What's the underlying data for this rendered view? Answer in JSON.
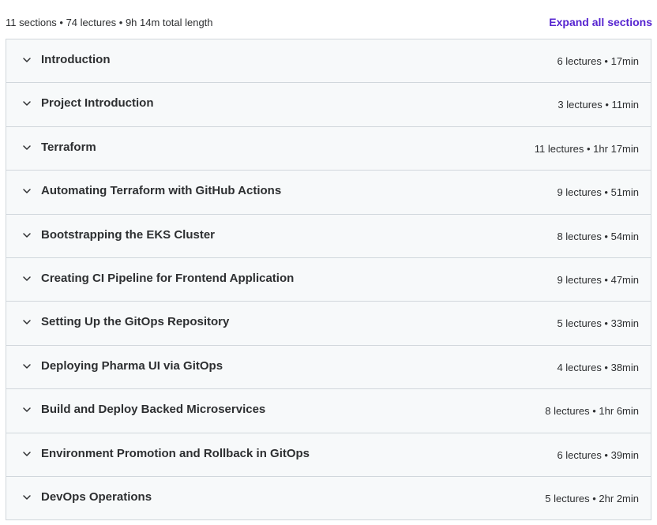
{
  "header": {
    "summary": "11 sections • 74 lectures • 9h 14m total length",
    "expand_all_label": "Expand all sections"
  },
  "sections": [
    {
      "title": "Introduction",
      "meta": "6 lectures • 17min",
      "icon": "chevron-down-icon"
    },
    {
      "title": "Project Introduction",
      "meta": "3 lectures • 11min",
      "icon": "chevron-down-icon"
    },
    {
      "title": "Terraform",
      "meta": "11 lectures • 1hr 17min",
      "icon": "chevron-down-icon"
    },
    {
      "title": "Automating Terraform with GitHub Actions",
      "meta": "9 lectures • 51min",
      "icon": "chevron-down-icon"
    },
    {
      "title": "Bootstrapping the EKS Cluster",
      "meta": "8 lectures • 54min",
      "icon": "chevron-down-icon"
    },
    {
      "title": "Creating CI Pipeline for Frontend Application",
      "meta": "9 lectures • 47min",
      "icon": "chevron-down-icon"
    },
    {
      "title": "Setting Up the GitOps Repository",
      "meta": "5 lectures • 33min",
      "icon": "chevron-down-icon"
    },
    {
      "title": "Deploying Pharma UI via GitOps",
      "meta": "4 lectures • 38min",
      "icon": "chevron-down-icon"
    },
    {
      "title": "Build and Deploy Backed Microservices",
      "meta": "8 lectures • 1hr 6min",
      "icon": "chevron-down-icon"
    },
    {
      "title": "Environment Promotion and Rollback in GitOps",
      "meta": "6 lectures • 39min",
      "icon": "chevron-down-icon"
    },
    {
      "title": "DevOps Operations",
      "meta": "5 lectures • 2hr 2min",
      "icon": "chevron-down-icon"
    }
  ],
  "colors": {
    "accent": "#5624d0",
    "section_bg": "#f7f9fa",
    "border": "#d1d7dc",
    "text": "#2d2f31"
  }
}
